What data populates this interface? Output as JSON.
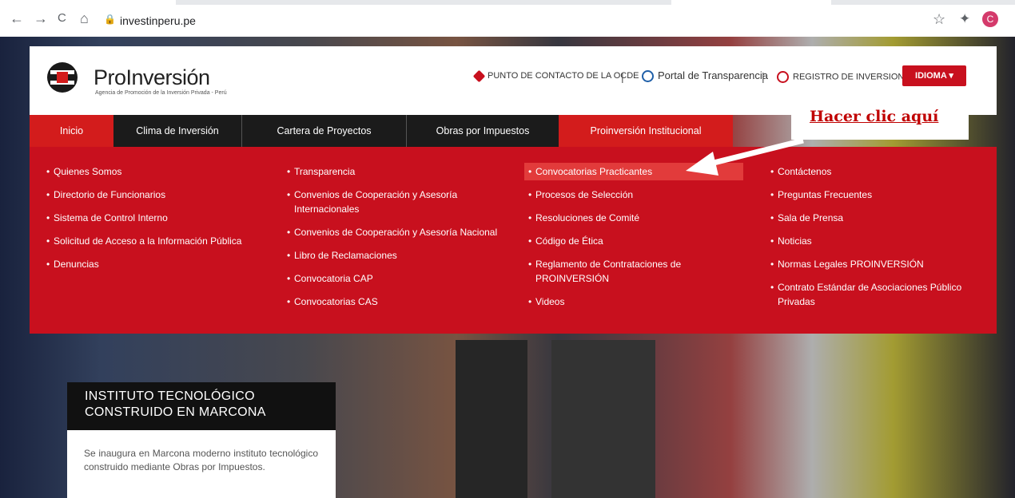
{
  "browser": {
    "url": "investinperu.pe",
    "back": "←",
    "forward": "→",
    "reload": "C",
    "home": "⌂",
    "lock": "🔒",
    "star": "☆",
    "extensions": "✦",
    "profile_initial": "C"
  },
  "header": {
    "brand": "ProInversión",
    "tagline": "Agencia de Promoción de la Inversión Privada - Perú",
    "links": [
      {
        "label": "PUNTO DE CONTACTO DE LA OCDE",
        "icon": "ocde-icon",
        "color": "#c8101e"
      },
      {
        "label": "Portal de Transparencia",
        "icon": "pte-icon",
        "color": "#1f5fa8"
      },
      {
        "label": "REGISTRO DE INVERSIONISTAS",
        "icon": "registro-icon",
        "color": "#c8101e"
      }
    ],
    "sep": "|",
    "idioma": "IDIOMA ▾"
  },
  "nav": {
    "items": [
      "Inicio",
      "Clima de Inversión",
      "Cartera de Proyectos",
      "Obras por Impuestos",
      "Proinversión Institucional"
    ]
  },
  "dropdown": {
    "col1": [
      "Quienes Somos",
      "Directorio de Funcionarios",
      "Sistema de Control Interno",
      "Solicitud de Acceso a la Información Pública",
      "Denuncias"
    ],
    "col2": [
      "Transparencia",
      "Convenios de Cooperación y Asesoría Internacionales",
      "Convenios de Cooperación y Asesoría Nacional",
      "Libro de Reclamaciones",
      "Convocatoria CAP",
      "Convocatorias CAS"
    ],
    "col3": [
      "Convocatorias Practicantes",
      "Procesos de Selección",
      "Resoluciones de Comité",
      "Código de Ética",
      "Reglamento de Contrataciones de PROINVERSIÓN",
      "Videos"
    ],
    "col4": [
      "Contáctenos",
      "Preguntas Frecuentes",
      "Sala de Prensa",
      "Noticias",
      "Normas Legales PROINVERSIÓN",
      "Contrato Estándar de Asociaciones Público Privadas"
    ]
  },
  "annotation": {
    "text": "Hacer clic aquí"
  },
  "hero": {
    "title": "INSTITUTO TECNOLÓGICO CONSTRUIDO EN MARCONA",
    "body": "Se inaugura en Marcona moderno instituto tecnológico construido mediante Obras por Impuestos."
  },
  "colors": {
    "brand_red": "#c8101e",
    "nav_dark": "#1b1b1b",
    "highlight": "#e23b3b",
    "annotation_red": "#c00000"
  }
}
